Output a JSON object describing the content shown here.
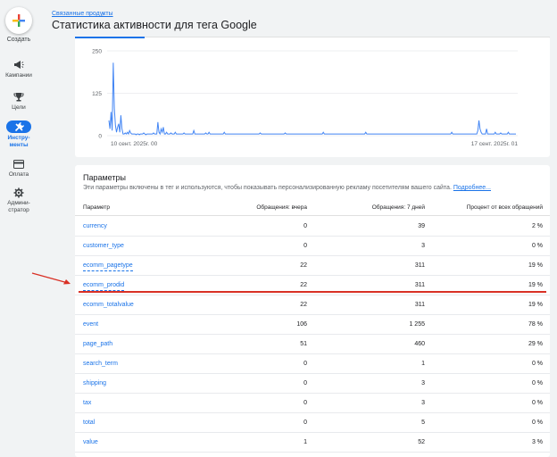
{
  "sidebar": {
    "create_label": "Создать",
    "items": [
      {
        "label": "Кампании",
        "icon": "megaphone-icon"
      },
      {
        "label": "Цели",
        "icon": "trophy-icon"
      },
      {
        "label": "Инстру-\nменты",
        "icon": "tools-icon",
        "active": true
      },
      {
        "label": "Оплата",
        "icon": "credit-card-icon"
      },
      {
        "label": "Админи-\nстратор",
        "icon": "gear-icon"
      }
    ]
  },
  "header": {
    "breadcrumb": "Связанные продукты",
    "title": "Статистика активности для тега Google"
  },
  "chart_data": {
    "type": "line",
    "title": "",
    "xlabel": "",
    "ylabel": "",
    "ylim": [
      0,
      250
    ],
    "yticks": [
      "0",
      "125",
      "250"
    ],
    "xtick_labels": [
      "10 сент. 2025г. 00",
      "17 сент. 2025г. 01"
    ],
    "series": [
      {
        "color": "#4285f4",
        "values": [
          45,
          20,
          70,
          15,
          215,
          80,
          30,
          10,
          25,
          35,
          10,
          60,
          20,
          5,
          5,
          8,
          5,
          10,
          5,
          15,
          8,
          5,
          5,
          5,
          5,
          3,
          5,
          5,
          3,
          5,
          5,
          5,
          8,
          5,
          3,
          5,
          5,
          5,
          5,
          5,
          5,
          8,
          5,
          5,
          5,
          40,
          10,
          5,
          20,
          10,
          25,
          5,
          5,
          10,
          5,
          5,
          5,
          8,
          5,
          5,
          5,
          10,
          5,
          5,
          5,
          5,
          5,
          5,
          5,
          8,
          5,
          5,
          5,
          5,
          5,
          5,
          5,
          5,
          15,
          5,
          5,
          5,
          5,
          5,
          5,
          5,
          5,
          5,
          5,
          8,
          5,
          5,
          10,
          5,
          5,
          5,
          5,
          5,
          5,
          5,
          5,
          5,
          5,
          5,
          5,
          5,
          10,
          5,
          5,
          5,
          5,
          5,
          5,
          5,
          5,
          5,
          5,
          5,
          5,
          5,
          5,
          5,
          5,
          5,
          5,
          5,
          5,
          5,
          5,
          5,
          5,
          5,
          5,
          5,
          5,
          5,
          5,
          5,
          5,
          8,
          5,
          5,
          5,
          5,
          5,
          5,
          5,
          5,
          5,
          5,
          5,
          5,
          5,
          5,
          5,
          5,
          5,
          5,
          5,
          5,
          5,
          5,
          8,
          5,
          5,
          5,
          5,
          5,
          5,
          5,
          5,
          5,
          5,
          5,
          5,
          5,
          5,
          5,
          5,
          5,
          5,
          5,
          5,
          5,
          5,
          5,
          5,
          5,
          5,
          5,
          5,
          5,
          5,
          5,
          5,
          5,
          5,
          10,
          5,
          5,
          5,
          5,
          5,
          5,
          5,
          5,
          5,
          5,
          5,
          5,
          5,
          5,
          5,
          5,
          5,
          5,
          5,
          5,
          5,
          5,
          5,
          5,
          5,
          5,
          5,
          5,
          5,
          5,
          5,
          5,
          5,
          5,
          5,
          5,
          5,
          5,
          10,
          5,
          5,
          5,
          5,
          5,
          5,
          5,
          5,
          5,
          5,
          5,
          5,
          5,
          5,
          5,
          5,
          5,
          5,
          5,
          5,
          5,
          5,
          5,
          5,
          5,
          5,
          5,
          5,
          5,
          5,
          5,
          5,
          5,
          5,
          5,
          5,
          5,
          5,
          5,
          5,
          5,
          5,
          5,
          5,
          5,
          5,
          5,
          5,
          5,
          5,
          5,
          5,
          5,
          5,
          5,
          5,
          5,
          5,
          5,
          5,
          5,
          5,
          5,
          5,
          5,
          5,
          5,
          5,
          5,
          5,
          5,
          5,
          5,
          5,
          5,
          5,
          5,
          5,
          10,
          5,
          5,
          5,
          5,
          5,
          5,
          5,
          5,
          5,
          5,
          5,
          5,
          5,
          5,
          5,
          5,
          5,
          5,
          5,
          5,
          5,
          5,
          5,
          15,
          45,
          20,
          10,
          5,
          5,
          5,
          5,
          20,
          5,
          5,
          5,
          5,
          5,
          5,
          5,
          10,
          5,
          5,
          5,
          5,
          8,
          5,
          5,
          5,
          5,
          5,
          5,
          10,
          5,
          5,
          5,
          5,
          5,
          5,
          5
        ]
      }
    ]
  },
  "params": {
    "title": "Параметры",
    "description": "Эти параметры включены в тег и используются, чтобы показывать персонализированную рекламу посетителям вашего сайта.",
    "more_link": "Подробнее...",
    "columns": [
      "Параметр",
      "Обращения: вчера",
      "Обращения: 7 дней",
      "Процент от всех обращений"
    ],
    "rows": [
      {
        "name": "currency",
        "yesterday": "0",
        "week": "39",
        "percent": "2 %"
      },
      {
        "name": "customer_type",
        "yesterday": "0",
        "week": "3",
        "percent": "0 %"
      },
      {
        "name": "ecomm_pagetype",
        "yesterday": "22",
        "week": "311",
        "percent": "19 %",
        "dotted": true
      },
      {
        "name": "ecomm_prodid",
        "yesterday": "22",
        "week": "311",
        "percent": "19 %",
        "dotted": true
      },
      {
        "name": "ecomm_totalvalue",
        "yesterday": "22",
        "week": "311",
        "percent": "19 %"
      },
      {
        "name": "event",
        "yesterday": "106",
        "week": "1 255",
        "percent": "78 %"
      },
      {
        "name": "page_path",
        "yesterday": "51",
        "week": "460",
        "percent": "29 %"
      },
      {
        "name": "search_term",
        "yesterday": "0",
        "week": "1",
        "percent": "0 %"
      },
      {
        "name": "shipping",
        "yesterday": "0",
        "week": "3",
        "percent": "0 %"
      },
      {
        "name": "tax",
        "yesterday": "0",
        "week": "3",
        "percent": "0 %"
      },
      {
        "name": "total",
        "yesterday": "0",
        "week": "5",
        "percent": "0 %"
      },
      {
        "name": "value",
        "yesterday": "1",
        "week": "52",
        "percent": "3 %"
      }
    ]
  },
  "colors": {
    "accent": "#1a73e8",
    "annotation": "#d93025",
    "line": "#4285f4"
  }
}
